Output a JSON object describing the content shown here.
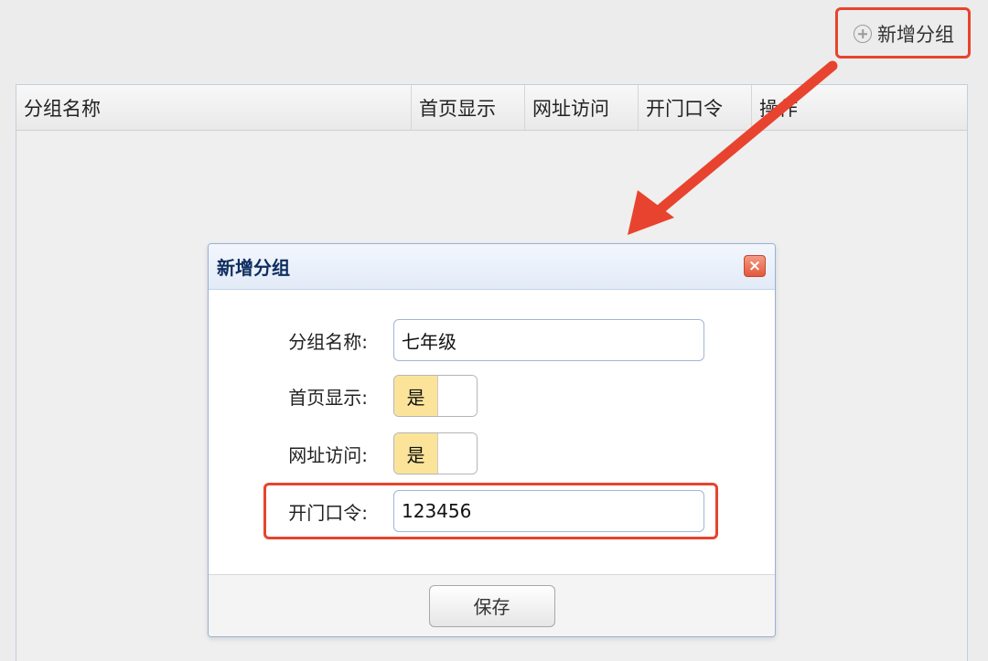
{
  "toolbar": {
    "add_group_label": "新增分组",
    "add_icon": "plus-circle-icon"
  },
  "grid": {
    "columns": [
      "分组名称",
      "首页显示",
      "网址访问",
      "开门口令",
      "操作"
    ]
  },
  "dialog": {
    "title": "新增分组",
    "close_icon": "close-icon",
    "fields": {
      "group_name_label": "分组名称:",
      "group_name_value": "七年级",
      "home_display_label": "首页显示:",
      "home_display_value": "是",
      "url_access_label": "网址访问:",
      "url_access_value": "是",
      "door_password_label": "开门口令:",
      "door_password_value": "123456"
    },
    "save_label": "保存"
  },
  "colors": {
    "highlight": "#e8432e",
    "toggle_on": "#fbe49a",
    "dialog_title": "#0e2d5f"
  }
}
